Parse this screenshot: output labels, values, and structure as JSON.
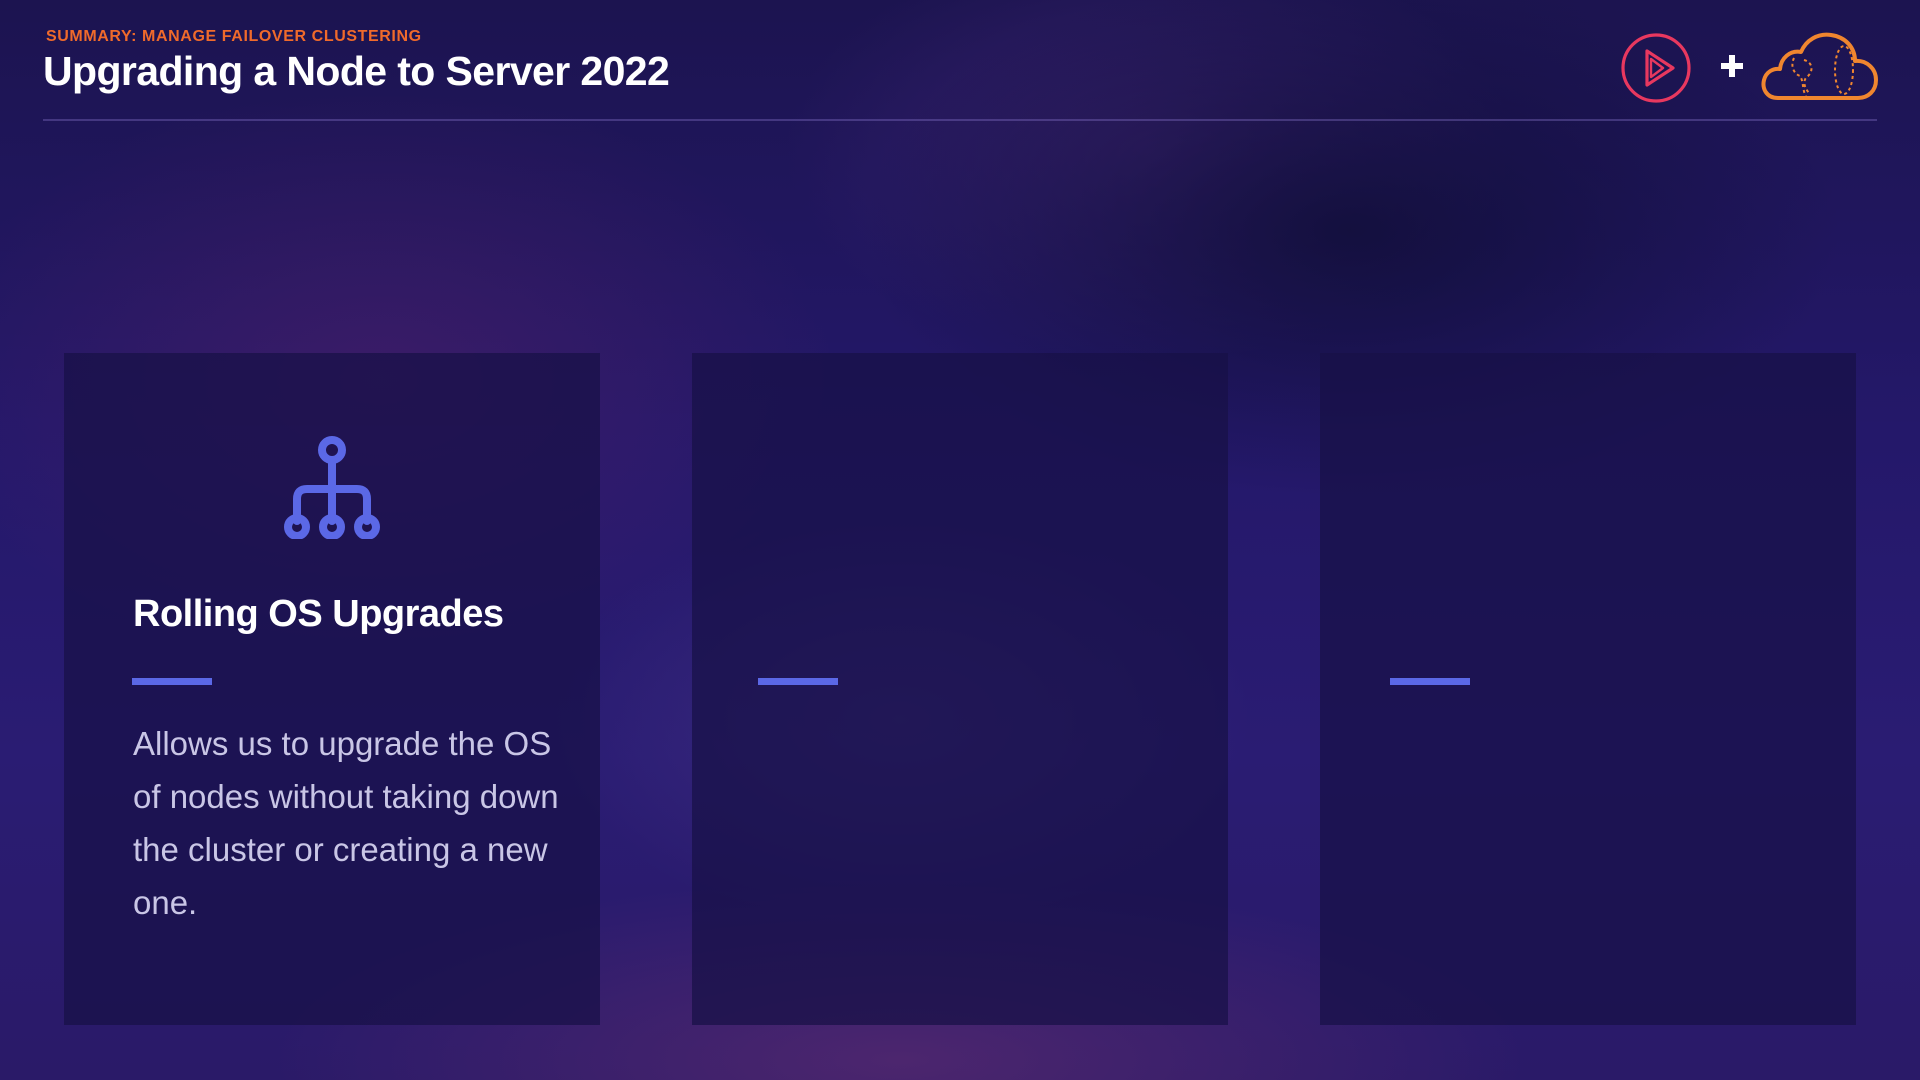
{
  "header": {
    "kicker": "SUMMARY: MANAGE FAILOVER CLUSTERING",
    "title": "Upgrading a Node to Server 2022"
  },
  "logos": {
    "items": [
      {
        "icon": "play-circle-logo-icon",
        "color": "#e8385f"
      },
      {
        "icon": "plus-icon",
        "color": "#ffffff"
      },
      {
        "icon": "cloud-logo-icon",
        "color": "#f0862f"
      }
    ]
  },
  "cards": [
    {
      "icon": "hierarchy-icon",
      "icon_color": "#5b68e6",
      "title": "Rolling OS Upgrades",
      "body": "Allows us to upgrade the OS of nodes without taking down the cluster or creating a new one."
    },
    {
      "icon": "",
      "title": "",
      "body": ""
    },
    {
      "icon": "",
      "title": "",
      "body": ""
    }
  ],
  "colors": {
    "accent": "#5b68e6",
    "kicker": "#f06a2b",
    "background": "#24186a"
  }
}
